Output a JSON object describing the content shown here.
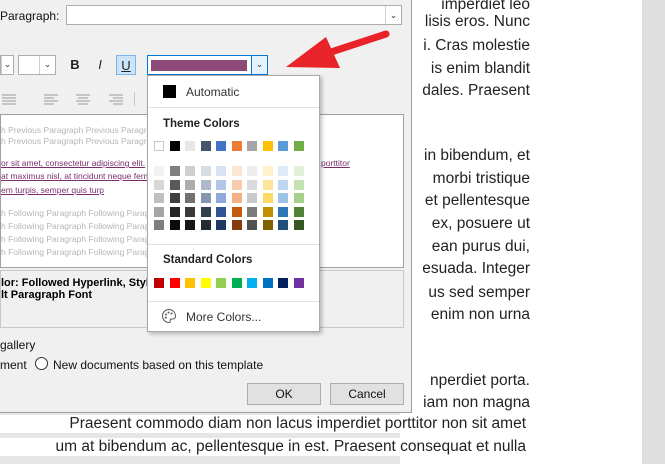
{
  "dialog": {
    "paragraph_label": "Paragraph:",
    "font_color_value": "#8b4a78",
    "format": {
      "bold": "B",
      "italic": "I",
      "underline": "U"
    },
    "preview": {
      "previous_1": "h Previous Paragraph Previous Paragraph",
      "previous_2": "h Previous Paragraph Previous Paragraph",
      "sample_1": "or sit amet, consectetur adipiscing elit.",
      "sample_2": "at maximus nisl, at tincidunt neque fermentum porttitor",
      "sample_3": "em turpis, semper quis turp",
      "sample_right": "porttitor",
      "following_1": "h Following Paragraph Following Paragraph",
      "following_2": "h Following Paragraph Following Paragraph",
      "following_3": "h Following Paragraph Following Paragraph",
      "following_4": "h Following Paragraph Following Paragraph"
    },
    "description_line_1": "lor: Followed Hyperlink, Style",
    "description_line_2": "lt Paragraph Font",
    "gallery_label": "gallery",
    "only_doc_label": "ment",
    "new_docs_label": "New documents based on this template",
    "ok_label": "OK",
    "cancel_label": "Cancel"
  },
  "palette": {
    "automatic_label": "Automatic",
    "theme_header": "Theme Colors",
    "standard_header": "Standard Colors",
    "more_colors_label": "More Colors...",
    "theme_top": [
      "#ffffff",
      "#000000",
      "#e7e6e6",
      "#44546a",
      "#4472c4",
      "#ed7d31",
      "#a5a5a5",
      "#ffc000",
      "#5b9bd5",
      "#70ad47"
    ],
    "theme_shades": [
      [
        "#f2f2f2",
        "#7f7f7f",
        "#d0cece",
        "#d6dce4",
        "#d9e2f3",
        "#fbe5d5",
        "#ededed",
        "#fff2cc",
        "#deebf6",
        "#e2efd9"
      ],
      [
        "#d8d8d8",
        "#595959",
        "#aeabab",
        "#adb9ca",
        "#b4c6e7",
        "#f7cbac",
        "#dbdbdb",
        "#fee599",
        "#bdd7ee",
        "#c5e0b3"
      ],
      [
        "#bfbfbf",
        "#3f3f3f",
        "#757070",
        "#8496b0",
        "#8eaadb",
        "#f4b183",
        "#c9c9c9",
        "#ffd965",
        "#9cc3e5",
        "#a8d08d"
      ],
      [
        "#a5a5a5",
        "#262626",
        "#3a3838",
        "#323f4f",
        "#2f5496",
        "#c55a11",
        "#7b7b7b",
        "#bf9000",
        "#2e75b5",
        "#538135"
      ],
      [
        "#7f7f7f",
        "#0c0c0c",
        "#171616",
        "#222a35",
        "#1f3864",
        "#833c0b",
        "#525252",
        "#7f6000",
        "#1e4e79",
        "#375623"
      ]
    ],
    "standard": [
      "#c00000",
      "#ff0000",
      "#ffc000",
      "#ffff00",
      "#92d050",
      "#00b050",
      "#00b0f0",
      "#0070c0",
      "#002060",
      "#7030a0"
    ]
  },
  "document": {
    "lines": [
      "imperdiet leo",
      "lisis eros. Nunc",
      "i. Cras molestie",
      "is enim blandit",
      "dales. Praesent",
      "in bibendum, et",
      "morbi tristique",
      "et pellentesque",
      "ex, posuere ut",
      "ean purus dui,",
      "esuada. Integer",
      "us sed semper",
      "enim non urna",
      "nperdiet porta.",
      "iam non magna"
    ],
    "bottom_lines": [
      "Praesent commodo diam non lacus imperdiet porttitor non sit amet",
      "um at bibendum ac, pellentesque in est. Praesent consequat et nulla"
    ]
  },
  "annotation": {
    "arrow_color": "#e8232a"
  }
}
